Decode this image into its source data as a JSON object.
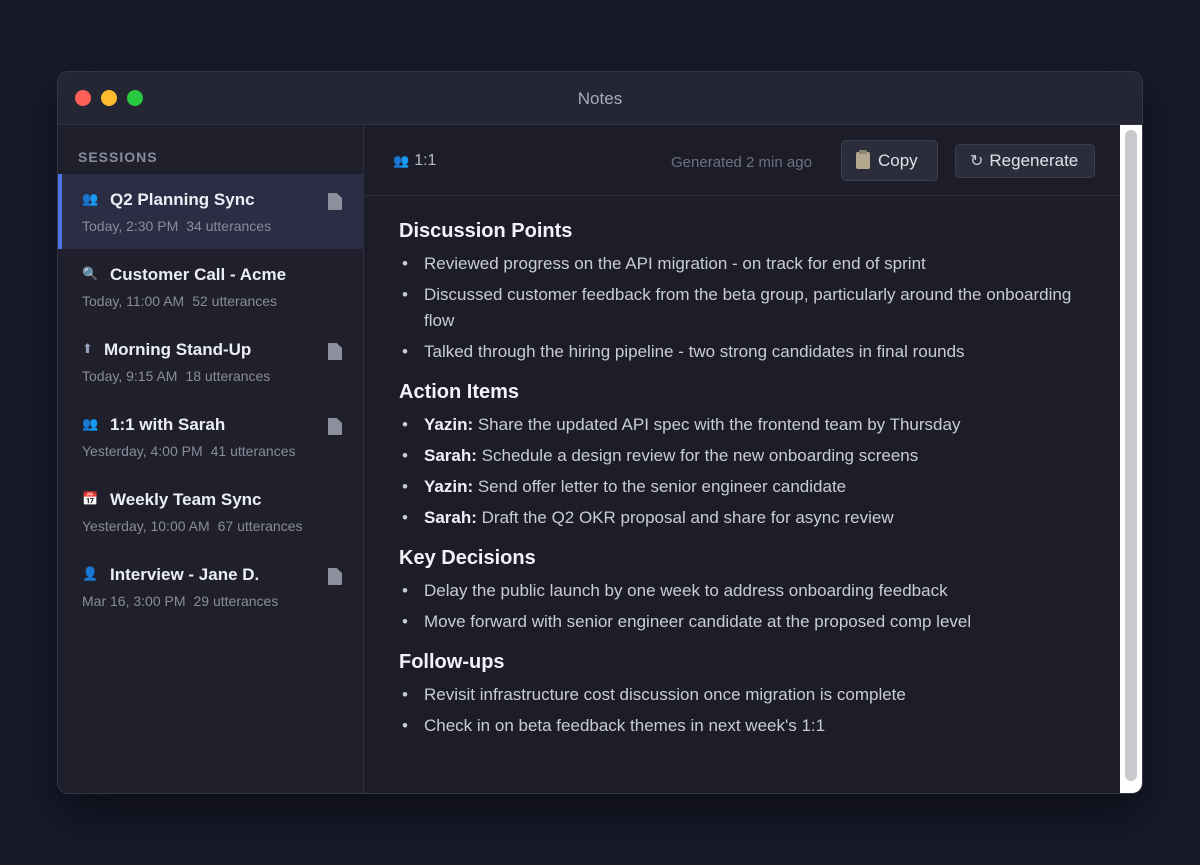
{
  "window": {
    "title": "Notes"
  },
  "sidebar": {
    "header": "SESSIONS",
    "sessions": [
      {
        "title": "Q2 Planning Sync",
        "time": "Today, 2:30 PM",
        "utterances": "34 utterances",
        "icon": "people-icon",
        "glyph": "👥",
        "has_doc": true,
        "active": true
      },
      {
        "title": "Customer Call - Acme",
        "time": "Today, 11:00 AM",
        "utterances": "52 utterances",
        "icon": "magnifier-icon",
        "glyph": "🔍",
        "has_doc": false,
        "active": false
      },
      {
        "title": "Morning Stand-Up",
        "time": "Today, 9:15 AM",
        "utterances": "18 utterances",
        "icon": "up-arrow-icon",
        "glyph": "⬆",
        "has_doc": true,
        "active": false
      },
      {
        "title": "1:1 with Sarah",
        "time": "Yesterday, 4:00 PM",
        "utterances": "41 utterances",
        "icon": "people-icon",
        "glyph": "👥",
        "has_doc": true,
        "active": false
      },
      {
        "title": "Weekly Team Sync",
        "time": "Yesterday, 10:00 AM",
        "utterances": "67 utterances",
        "icon": "calendar-icon",
        "glyph": "📅",
        "has_doc": false,
        "active": false
      },
      {
        "title": "Interview - Jane D.",
        "time": "Mar 16, 3:00 PM",
        "utterances": "29 utterances",
        "icon": "person-icon",
        "glyph": "👤",
        "has_doc": true,
        "active": false
      }
    ]
  },
  "toolbar": {
    "mode_icon": "👥",
    "mode_label": "1:1",
    "generated": "Generated 2 min ago",
    "copy_label": "Copy",
    "regenerate_label": "Regenerate",
    "regen_glyph": "↻"
  },
  "notes": {
    "discussion": {
      "heading": "Discussion Points",
      "items": [
        "Reviewed progress on the API migration - on track for end of sprint",
        "Discussed customer feedback from the beta group, particularly around the onboarding flow",
        "Talked through the hiring pipeline - two strong candidates in final rounds"
      ]
    },
    "actions": {
      "heading": "Action Items",
      "items": [
        {
          "owner": "Yazin:",
          "text": " Share the updated API spec with the frontend team by Thursday"
        },
        {
          "owner": "Sarah:",
          "text": " Schedule a design review for the new onboarding screens"
        },
        {
          "owner": "Yazin:",
          "text": " Send offer letter to the senior engineer candidate"
        },
        {
          "owner": "Sarah:",
          "text": " Draft the Q2 OKR proposal and share for async review"
        }
      ]
    },
    "decisions": {
      "heading": "Key Decisions",
      "items": [
        "Delay the public launch by one week to address onboarding feedback",
        "Move forward with senior engineer candidate at the proposed comp level"
      ]
    },
    "followups": {
      "heading": "Follow-ups",
      "items": [
        "Revisit infrastructure cost discussion once migration is complete",
        "Check in on beta feedback themes in next week's 1:1"
      ]
    }
  },
  "colors": {
    "accent": "#4d74e8",
    "active_bg": "#2a2d44",
    "window_bg": "#1c1d28",
    "desktop_bg": "#181a2b"
  }
}
